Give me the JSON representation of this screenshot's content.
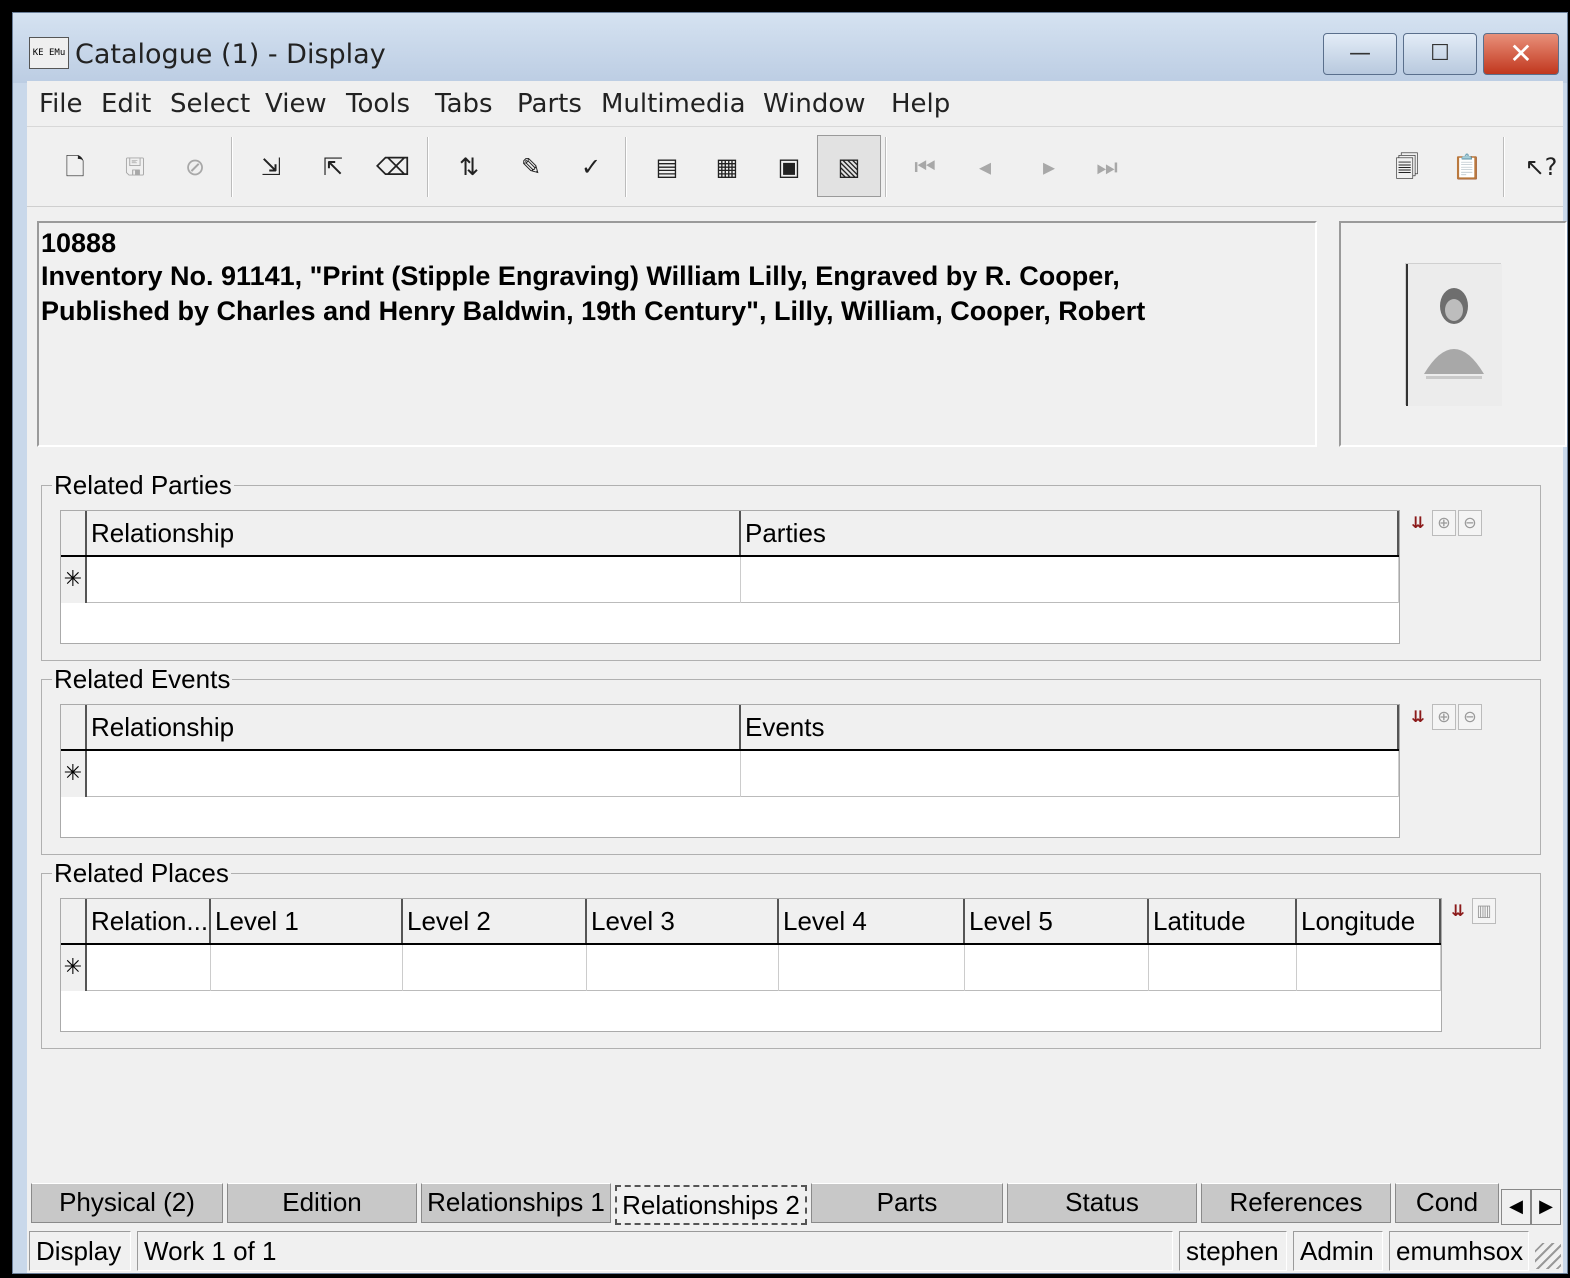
{
  "window": {
    "title": "Catalogue (1) - Display",
    "app_icon_label": "KE EMu",
    "controls": {
      "minimize": "—",
      "maximize": "☐",
      "close": "✕"
    }
  },
  "menu": [
    "File",
    "Edit",
    "Select",
    "View",
    "Tools",
    "Tabs",
    "Parts",
    "Multimedia",
    "Window",
    "Help"
  ],
  "toolbar": {
    "icons": [
      "new-record-icon",
      "save-icon",
      "cancel-icon",
      "import-icon",
      "export-icon",
      "delete-icon",
      "sort-icon",
      "edit-icon",
      "spellcheck-icon",
      "details-view-icon",
      "list-view-icon",
      "page-view-icon",
      "display-view-icon",
      "first-record-icon",
      "previous-record-icon",
      "next-record-icon",
      "last-record-icon",
      "copy-record-icon",
      "paste-record-icon",
      "help-cursor-icon"
    ]
  },
  "summary": {
    "irn": "10888",
    "line1": "Inventory No. 91141, \"Print (Stipple Engraving) William Lilly, Engraved by R. Cooper,",
    "line2": "Published by Charles and Henry Baldwin, 19th Century\", Lilly, William, Cooper, Robert"
  },
  "related_parties": {
    "title": "Related Parties",
    "columns": [
      "Relationship",
      "Parties"
    ],
    "new_row_marker": "✳"
  },
  "related_events": {
    "title": "Related Events",
    "columns": [
      "Relationship",
      "Events"
    ],
    "new_row_marker": "✳"
  },
  "related_places": {
    "title": "Related Places",
    "columns": [
      "Relation...",
      "Level 1",
      "Level 2",
      "Level 3",
      "Level 4",
      "Level 5",
      "Latitude",
      "Longitude"
    ],
    "new_row_marker": "✳"
  },
  "tabs": [
    {
      "label": "Physical (2)",
      "active": false
    },
    {
      "label": "Edition",
      "active": false
    },
    {
      "label": "Relationships 1",
      "active": false
    },
    {
      "label": "Relationships 2",
      "active": true
    },
    {
      "label": "Parts",
      "active": false
    },
    {
      "label": "Status",
      "active": false
    },
    {
      "label": "References",
      "active": false
    },
    {
      "label": "Cond",
      "active": false
    }
  ],
  "status": {
    "mode": "Display",
    "record": "Work 1 of 1",
    "user": "stephen",
    "group": "Admin",
    "host": "emumhsox"
  }
}
